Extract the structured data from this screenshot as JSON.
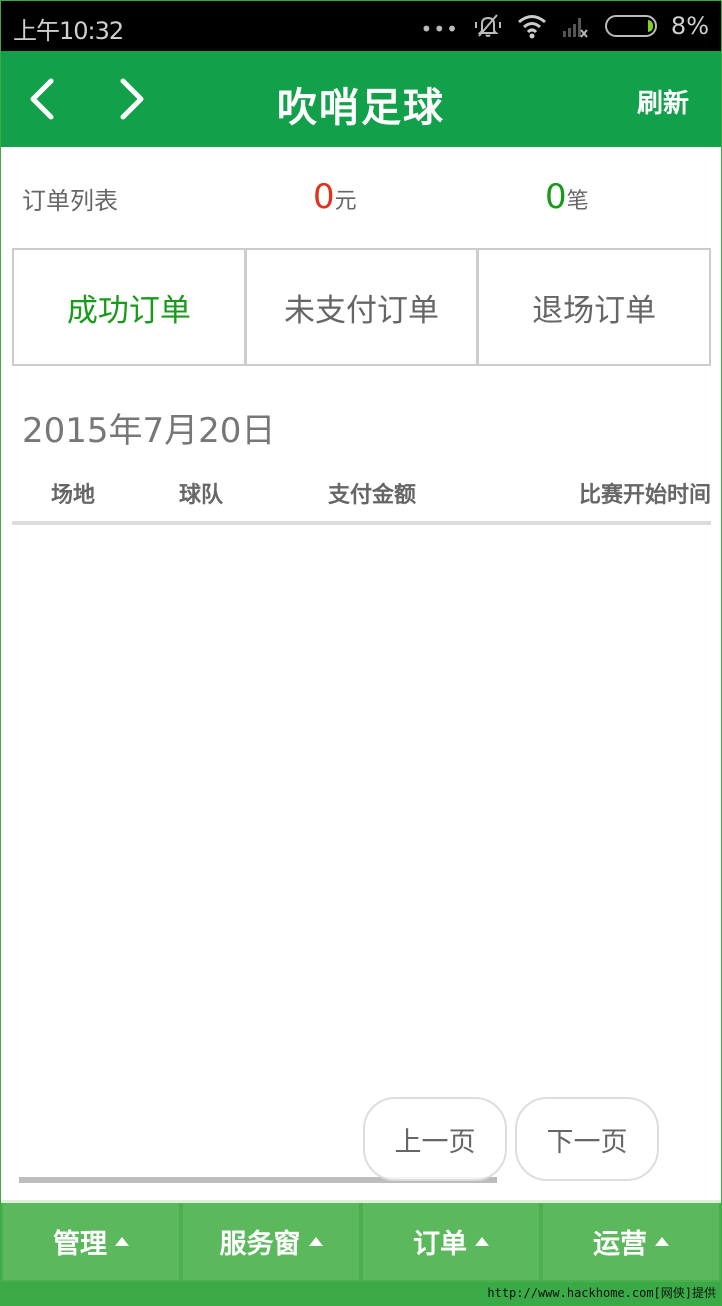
{
  "status_bar": {
    "time": "上午10:32",
    "dots": "•••",
    "icons": [
      "silent-bell-icon",
      "wifi-icon",
      "signal-no-service-icon",
      "battery-icon"
    ],
    "battery_percent": "8%"
  },
  "app_bar": {
    "title": "吹哨足球",
    "back_icon": "chevron-left-icon",
    "forward_icon": "chevron-right-icon",
    "refresh_label": "刷新"
  },
  "summary": {
    "label": "订单列表",
    "amount_value": "0",
    "amount_unit": "元",
    "count_value": "0",
    "count_unit": "笔",
    "amount_color": "#e0321c",
    "count_color": "#1a9a1a"
  },
  "tabs": [
    {
      "label": "成功订单",
      "active": true
    },
    {
      "label": "未支付订单",
      "active": false
    },
    {
      "label": "退场订单",
      "active": false
    }
  ],
  "date": "2015年7月20日",
  "table": {
    "columns": [
      "场地",
      "球队",
      "支付金额",
      "比赛开始时间"
    ],
    "rows": []
  },
  "pagination": {
    "prev_label": "上一页",
    "next_label": "下一页"
  },
  "bottom_nav": [
    {
      "label": "管理"
    },
    {
      "label": "服务窗"
    },
    {
      "label": "订单"
    },
    {
      "label": "运营"
    }
  ],
  "watermark": "http://www.hackhome.com[网侠]提供",
  "colors": {
    "primary": "#13a04a",
    "bottom_nav": "#5cb85c",
    "active_tab": "#1a9a1a"
  }
}
